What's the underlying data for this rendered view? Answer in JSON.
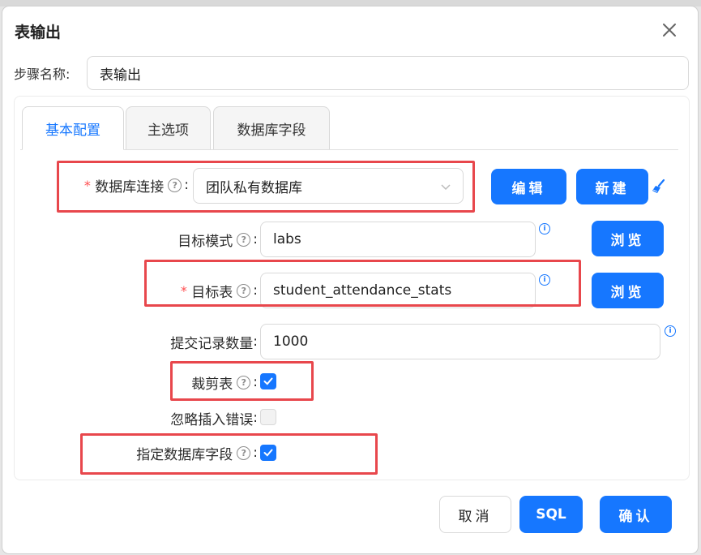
{
  "dialog": {
    "title": "表输出",
    "close_glyph": "×"
  },
  "step_name": {
    "label": "步骤名称:",
    "value": "表输出"
  },
  "tabs": [
    {
      "label": "基本配置",
      "active": true
    },
    {
      "label": "主选项",
      "active": false
    },
    {
      "label": "数据库字段",
      "active": false
    }
  ],
  "form": {
    "db_connection": {
      "required_mark": "*",
      "label": "数据库连接",
      "colon": ":",
      "value": "团队私有数据库",
      "help": "?"
    },
    "edit_button": "编辑",
    "new_button": "新建",
    "target_schema": {
      "label": "目标模式",
      "colon": ":",
      "value": "labs",
      "help": "?",
      "info": "i"
    },
    "browse_button_1": "浏览",
    "target_table": {
      "required_mark": "*",
      "label": "目标表",
      "colon": ":",
      "value": "student_attendance_stats",
      "help": "?",
      "info": "i"
    },
    "browse_button_2": "浏览",
    "commit_size": {
      "label": "提交记录数量",
      "colon": ":",
      "value": "1000",
      "info": "i"
    },
    "truncate_table": {
      "label": "裁剪表",
      "colon": ":",
      "checked": true,
      "help": "?"
    },
    "ignore_insert_errors": {
      "label": "忽略插入错误",
      "colon": ":",
      "checked": false
    },
    "specify_db_fields": {
      "label": "指定数据库字段",
      "colon": ":",
      "checked": true,
      "help": "?"
    }
  },
  "footer": {
    "cancel": "取消",
    "sql": "SQL",
    "confirm": "确认"
  },
  "colors": {
    "primary": "#1677ff",
    "highlight_box": "#e8474c",
    "required": "#ff4d4f"
  },
  "icons": {
    "clean": "broom-icon",
    "close": "close-icon",
    "dropdown": "chevron-down-icon"
  }
}
